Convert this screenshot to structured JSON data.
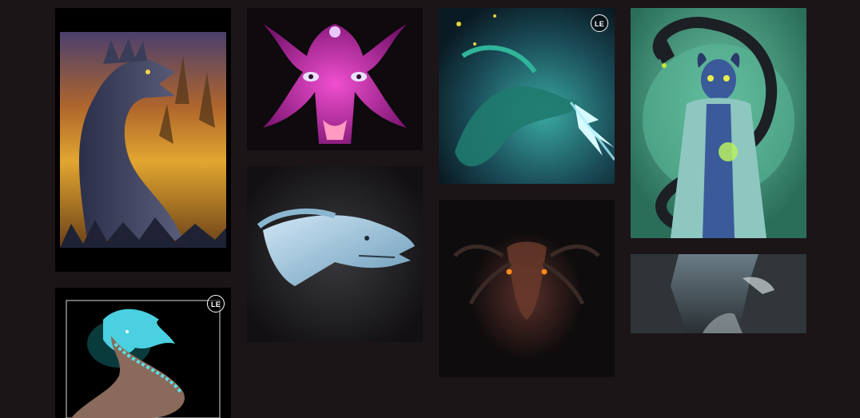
{
  "gallery": {
    "items": [
      {
        "subject": "dragon-sunset-painting",
        "badge": ""
      },
      {
        "subject": "magenta-demon-face",
        "badge": ""
      },
      {
        "subject": "teal-lightning-dragon",
        "badge": "LE"
      },
      {
        "subject": "horned-sorceress-with-dragon",
        "badge": ""
      },
      {
        "subject": "silver-dragon-head",
        "badge": ""
      },
      {
        "subject": "dark-dragon-orange-eyes",
        "badge": ""
      },
      {
        "subject": "misty-canyon-dragon",
        "badge": ""
      },
      {
        "subject": "eastern-dragon-teal-mane",
        "badge": "LE"
      }
    ]
  }
}
